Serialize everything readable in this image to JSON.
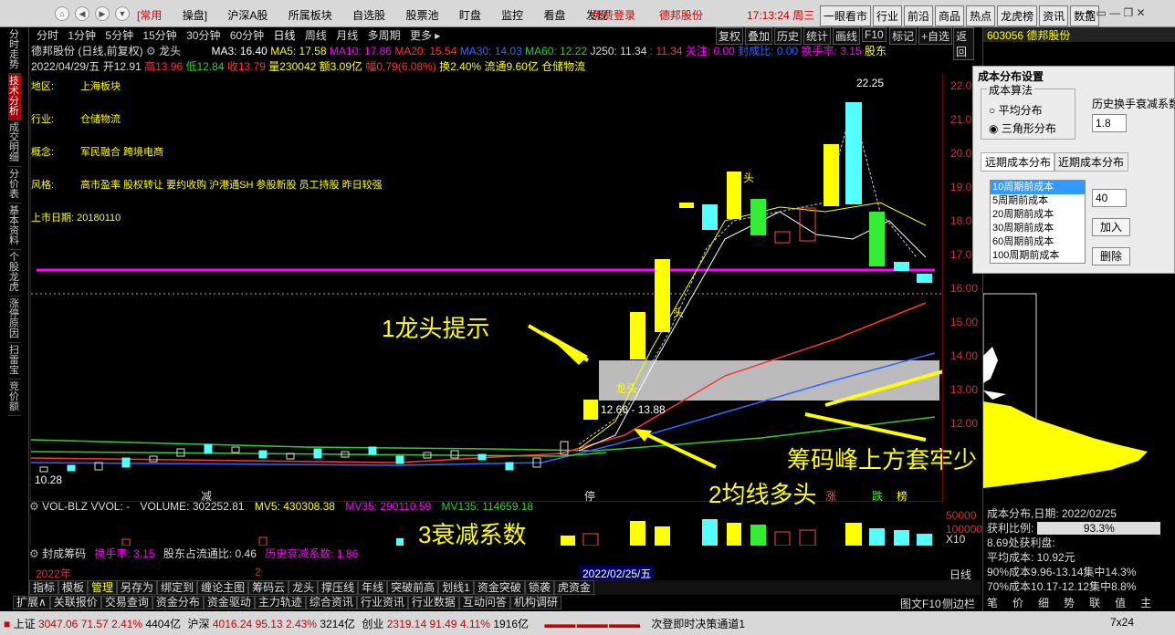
{
  "topbar": {
    "nav": [
      "⌂",
      "◀",
      "▶",
      "▼"
    ],
    "menu": [
      "[常用",
      "操盘]",
      "沪深A股",
      "所属板块",
      "自选股",
      "股票池",
      "盯盘",
      "监控",
      "看盘",
      "发现"
    ],
    "login": "免费登录",
    "stock_name": "德邦股份",
    "time": "17:13:24",
    "weekday": "周三",
    "quick": [
      "一眼看市",
      "行业",
      "前沿",
      "商品",
      "热点",
      "龙虎榜",
      "资讯",
      "数据"
    ]
  },
  "lefttabs": [
    "分时走势",
    "技术分析",
    "成交明细",
    "分价表",
    "基本资料",
    "个股龙虎",
    "涨停原因",
    "扫雷宝",
    "竞价额"
  ],
  "chartbar": {
    "periods": [
      "分时",
      "1分钟",
      "5分钟",
      "15分钟",
      "30分钟",
      "60分钟",
      "日线",
      "周线",
      "月线",
      "多周期",
      "更多 ▸"
    ],
    "buttons": [
      "复权",
      "叠加",
      "历史",
      "统计",
      "画线",
      "F10",
      "标记",
      "+自选",
      "返回"
    ]
  },
  "info": {
    "title": "德邦股份 (日线,前复权)",
    "indicator": "龙头",
    "ma3": "MA3: 16.40",
    "ma5": "MA5: 17.58",
    "ma10": "MA10: 17.86",
    "ma20": "MA20: 15.54",
    "ma30": "MA30: 14.03",
    "ma60": "MA60: 12.22",
    "j250": "J250: 11.34",
    "j250b": ": 11.34",
    "attention": "关注: 0.00",
    "seal": "封成比: 0.00",
    "turnover": "换手率: 3.15",
    "extra": "股东",
    "date": "2022/04/29/五",
    "open": "开12.91",
    "high": "高13.96",
    "low": "低12.84",
    "close": "收13.79",
    "volume": "量230042",
    "amount": "额3.09亿",
    "change": "幅0.79(6.08%)",
    "hand": "换2.40%",
    "float": "流通9.60亿",
    "sector": "仓储物流"
  },
  "fund": {
    "region_label": "地区:",
    "region": "上海板块",
    "industry_label": "行业:",
    "industry": "仓储物流",
    "concept_label": "概念:",
    "concept": "军民融合 跨境电商",
    "style_label": "风格:",
    "style": "高市盈率 股权转让 要约收购 沪港通SH 参股新股 员工持股 昨日较强",
    "listing": "上市日期: 20180110"
  },
  "chart_labels": {
    "high": "22.25",
    "low": "10.28",
    "range": "12.66 - 13.88",
    "dragon": "龙头",
    "dragon_small": "头",
    "dragon_small2": "头",
    "marks": [
      "减",
      "停",
      "涨",
      "跌",
      "榜"
    ],
    "yticks": [
      "22.00",
      "21.00",
      "20.00",
      "19.00",
      "18.00",
      "17.00",
      "16.00",
      "15.00",
      "14.00",
      "13.00",
      "12.00"
    ]
  },
  "annotations": {
    "a1": "1龙头提示",
    "a2": "2均线多头",
    "a3": "3衰减系数",
    "a4": "筹码峰上方套牢少"
  },
  "vol": {
    "title": "VOL-BLZ VVOL: -",
    "volume": "VOLUME: 302252.81",
    "mv5": "MV5: 430308.38",
    "mv35": "MV35: 290110.59",
    "mv135": "MV135: 114659.18",
    "yticks": [
      "50000",
      "100000"
    ],
    "unit": "X10"
  },
  "ind2": {
    "title": "封成筹码",
    "turnover": "换手率: 3.15",
    "ratio": "股东占流通比: 0.46",
    "decay": "历史衰减系数: 1.86"
  },
  "dateaxis": {
    "year": "2022年",
    "month": "2",
    "cursor": "2022/02/25/五"
  },
  "bottomtabs": [
    "指标",
    "模板",
    "管理",
    "另存为",
    "绑定到",
    "缠论主图",
    "筹码云",
    "龙头",
    "撑压线",
    "年线",
    "突破前高",
    "划线1",
    "资金突破",
    "锁袭",
    "虎资金"
  ],
  "exttabs": [
    "扩展∧",
    "关联报价",
    "交易查询",
    "资金分布",
    "资金驱动",
    "主力轨迹",
    "综合资讯",
    "行业资讯",
    "行业数据",
    "互动问答",
    "机构调研"
  ],
  "status": {
    "sh_name": "上证",
    "sh_val": "3047.06",
    "sh_chg": "71.57",
    "sh_pct": "2.41%",
    "sh_amt": "4404亿",
    "sz_name": "沪深",
    "sz_val": "4016.24",
    "sz_chg": "95.13",
    "sz_pct": "2.43%",
    "sz_amt": "3214亿",
    "cy_name": "创业",
    "cy_val": "2319.14",
    "cy_chg": "91.49",
    "cy_pct": "4.11%",
    "cy_amt": "1916亿",
    "message": "次登即时决策通道1",
    "extra": "7x24"
  },
  "right": {
    "code": "603056",
    "name": "德邦股份",
    "dialog_title": "成本分布设置",
    "algo_label": "成本算法",
    "opt1": "平均分布",
    "opt2": "三角形分布",
    "decay_label": "历史换手衰减系数",
    "decay_val": "1.8",
    "tab1": "远期成本分布",
    "tab2": "近期成本分布",
    "list": [
      "10周期前成本",
      "5周期前成本",
      "20周期前成本",
      "30周期前成本",
      "60周期前成本",
      "100周期前成本"
    ],
    "period_val": "40",
    "add": "加入",
    "del": "删除",
    "stat_title": "成本分布,日期: 2022/02/25",
    "profit_label": "获利比例:",
    "profit": "93.3%",
    "profit_price": "8.69处获利盘:",
    "avg": "平均成本: 10.92元",
    "c90": "90%成本9.96-13.14集中14.3%",
    "c70": "70%成本10.17-12.12集中8.8%",
    "rtabs": [
      "笔",
      "价",
      "细",
      "势",
      "联",
      "值",
      "主"
    ],
    "daily": "日线",
    "f10": "图文F10",
    "sidebar": "侧边栏"
  }
}
